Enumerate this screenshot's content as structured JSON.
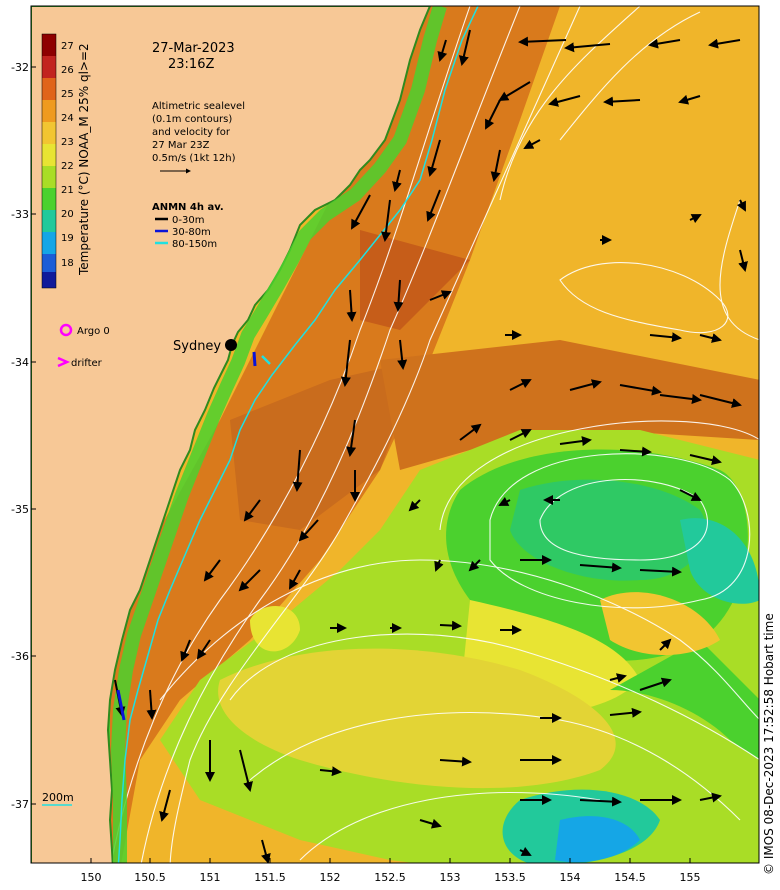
{
  "header": {
    "date": "27-Mar-2023",
    "time": "23:16Z"
  },
  "colorbar": {
    "label": "Temperature (°C) NOAA_M 25% ql>=2",
    "ticks": [
      "27",
      "26",
      "25",
      "24",
      "23",
      "22",
      "21",
      "20",
      "19",
      "18"
    ],
    "colors": [
      "#8e0000",
      "#c2241f",
      "#e0641a",
      "#ef9a1f",
      "#f2c531",
      "#e8e433",
      "#a9dd26",
      "#4bd12e",
      "#22c99b",
      "#15a6e6",
      "#1c5dd6",
      "#101a9a"
    ]
  },
  "legend": {
    "altimetry_lines": [
      "Altimetric sealevel",
      "(0.1m contours)",
      "and velocity for",
      "27 Mar 23Z",
      "0.5m/s (1kt 12h)"
    ],
    "anmn_title": "ANMN 4h av.",
    "anmn_items": [
      {
        "label": "0-30m",
        "color": "#000000"
      },
      {
        "label": "30-80m",
        "color": "#0b14d8"
      },
      {
        "label": "80-150m",
        "color": "#20e0e0"
      }
    ],
    "argo_label": "Argo 0",
    "drifter_label": "drifter",
    "argo_color": "#ff00ff",
    "drifter_color": "#ff00ff"
  },
  "place_labels": {
    "sydney": "Sydney",
    "isobath": "200m"
  },
  "axes": {
    "lon_ticks": [
      "150",
      "150.5",
      "151",
      "151.5",
      "152",
      "152.5",
      "153",
      "153.5",
      "154",
      "154.5",
      "155"
    ],
    "lat_ticks": [
      "-32",
      "-33",
      "-34",
      "-35",
      "-36",
      "-37"
    ]
  },
  "credit": "© IMOS 08-Dec-2023 17:52:58 Hobart time",
  "colors": {
    "land": "#f7c896",
    "coast_edge": "#2e8b1e",
    "vector": "#000000",
    "contour": "#ffffff"
  }
}
